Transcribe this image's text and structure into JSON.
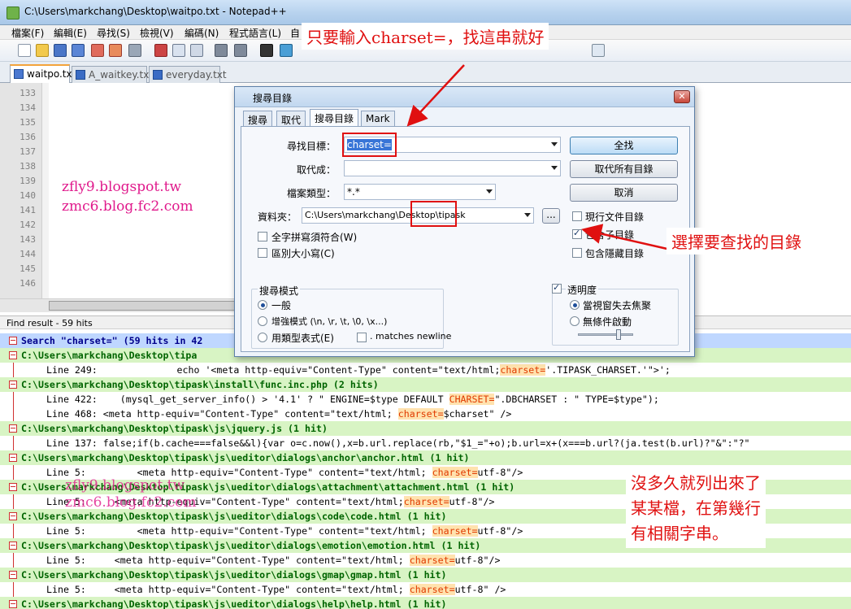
{
  "window": {
    "title": "C:\\Users\\markchang\\Desktop\\waitpo.txt - Notepad++"
  },
  "menu": [
    "檔案(F)",
    "編輯(E)",
    "尋找(S)",
    "檢視(V)",
    "編碼(N)",
    "程式語言(L)",
    "自"
  ],
  "tabs": [
    {
      "label": "waitpo.txt",
      "active": true
    },
    {
      "label": "A_waitkey.txt",
      "active": false
    },
    {
      "label": "everyday.txt",
      "active": false
    }
  ],
  "editor": {
    "line_numbers": [
      "133",
      "134",
      "135",
      "136",
      "137",
      "138",
      "139",
      "140",
      "141",
      "142",
      "143",
      "144",
      "145",
      "146"
    ]
  },
  "watermark": {
    "line1": "zfly9.blogspot.tw",
    "line2": "zmc6.blog.fc2.com"
  },
  "dialog": {
    "title": "搜尋目錄",
    "tabs": [
      "搜尋",
      "取代",
      "搜尋目錄",
      "Mark"
    ],
    "find_label": "尋找目標：",
    "find_value": "charset=",
    "replace_label": "取代成：",
    "replace_value": "",
    "filter_label": "檔案類型：",
    "filter_value": "*.*",
    "dir_label": "資料夾：",
    "dir_value": "C:\\Users\\markchang\\Desktop\\tipask",
    "browse_label": "...",
    "btn_find_all": "全找",
    "btn_replace_all": "取代所有目錄",
    "btn_cancel": "取消",
    "opt_current_doc": "現行文件目錄",
    "opt_subfolders": "包含子目錄",
    "opt_hidden": "包含隱藏目錄",
    "opt_whole_word": "全字拼寫須符合(W)",
    "opt_match_case": "區別大小寫(C)",
    "search_mode_title": "搜尋模式",
    "mode_normal": "一般",
    "mode_extended": "增強模式 (\\n, \\r, \\t, \\0, \\x...)",
    "mode_regex": "用類型表式(E)",
    "opt_newline": ". matches newline",
    "transparency_title": "透明度",
    "trans_on_lose_focus": "當視窗失去焦聚",
    "trans_always": "無條件啟動"
  },
  "find_result": {
    "header": "Find result - 59 hits",
    "rows": [
      {
        "type": "search",
        "text": "Search \"charset=\" (59 hits in 42"
      },
      {
        "type": "file",
        "text": "C:\\Users\\markchang\\Desktop\\tipa"
      },
      {
        "type": "line",
        "pre": "Line 249:              echo '<meta http-equiv=\"Content-Type\" content=\"text/html;",
        "hl": "charset=",
        "post": "'.TIPASK_CHARSET.'\">';"
      },
      {
        "type": "file",
        "text": "C:\\Users\\markchang\\Desktop\\tipask\\install\\func.inc.php (2 hits)"
      },
      {
        "type": "line",
        "pre": "Line 422:    (mysql_get_server_info() > '4.1' ? \" ENGINE=$type DEFAULT ",
        "hl": "CHARSET=",
        "post": "\".DBCHARSET : \" TYPE=$type\");"
      },
      {
        "type": "line",
        "pre": "Line 468: <meta http-equiv=\"Content-Type\" content=\"text/html; ",
        "hl": "charset=",
        "post": "$charset\" />"
      },
      {
        "type": "file",
        "text": "C:\\Users\\markchang\\Desktop\\tipask\\js\\jquery.js (1 hit)"
      },
      {
        "type": "line",
        "pre": "Line 137: false;if(b.cache===false&&l){var o=c.now(),x=b.url.replace(rb,\"$1_=\"+o);b.url=x+(x===b.url?(ja.test(b.url)?\"&\":\"?\"",
        "hl": "",
        "post": ""
      },
      {
        "type": "file",
        "text": "C:\\Users\\markchang\\Desktop\\tipask\\js\\ueditor\\dialogs\\anchor\\anchor.html (1 hit)"
      },
      {
        "type": "line",
        "pre": "Line 5:         <meta http-equiv=\"Content-Type\" content=\"text/html; ",
        "hl": "charset=",
        "post": "utf-8\"/>"
      },
      {
        "type": "file",
        "text": "C:\\Users\\markchang\\Desktop\\tipask\\js\\ueditor\\dialogs\\attachment\\attachment.html (1 hit)"
      },
      {
        "type": "line",
        "pre": "Line 5:     <meta http-equiv=\"Content-Type\" content=\"text/html;",
        "hl": "charset=",
        "post": "utf-8\"/>"
      },
      {
        "type": "file",
        "text": "C:\\Users\\markchang\\Desktop\\tipask\\js\\ueditor\\dialogs\\code\\code.html (1 hit)"
      },
      {
        "type": "line",
        "pre": "Line 5:         <meta http-equiv=\"Content-Type\" content=\"text/html; ",
        "hl": "charset=",
        "post": "utf-8\"/>"
      },
      {
        "type": "file",
        "text": "C:\\Users\\markchang\\Desktop\\tipask\\js\\ueditor\\dialogs\\emotion\\emotion.html (1 hit)"
      },
      {
        "type": "line",
        "pre": "Line 5:     <meta http-equiv=\"Content-Type\" content=\"text/html; ",
        "hl": "charset=",
        "post": "utf-8\"/>"
      },
      {
        "type": "file",
        "text": "C:\\Users\\markchang\\Desktop\\tipask\\js\\ueditor\\dialogs\\gmap\\gmap.html (1 hit)"
      },
      {
        "type": "line",
        "pre": "Line 5:     <meta http-equiv=\"Content-Type\" content=\"text/html; ",
        "hl": "charset=",
        "post": "utf-8\" />"
      },
      {
        "type": "file",
        "text": "C:\\Users\\markchang\\Desktop\\tipask\\js\\ueditor\\dialogs\\help\\help.html (1 hit)"
      }
    ]
  },
  "annotations": {
    "top": "只要輸入charset=，找這串就好",
    "right": "選擇要查找的目錄",
    "bottom_line1": "沒多久就列出來了",
    "bottom_line2": "某某檔，在第幾行",
    "bottom_line3": "有相關字串。"
  }
}
